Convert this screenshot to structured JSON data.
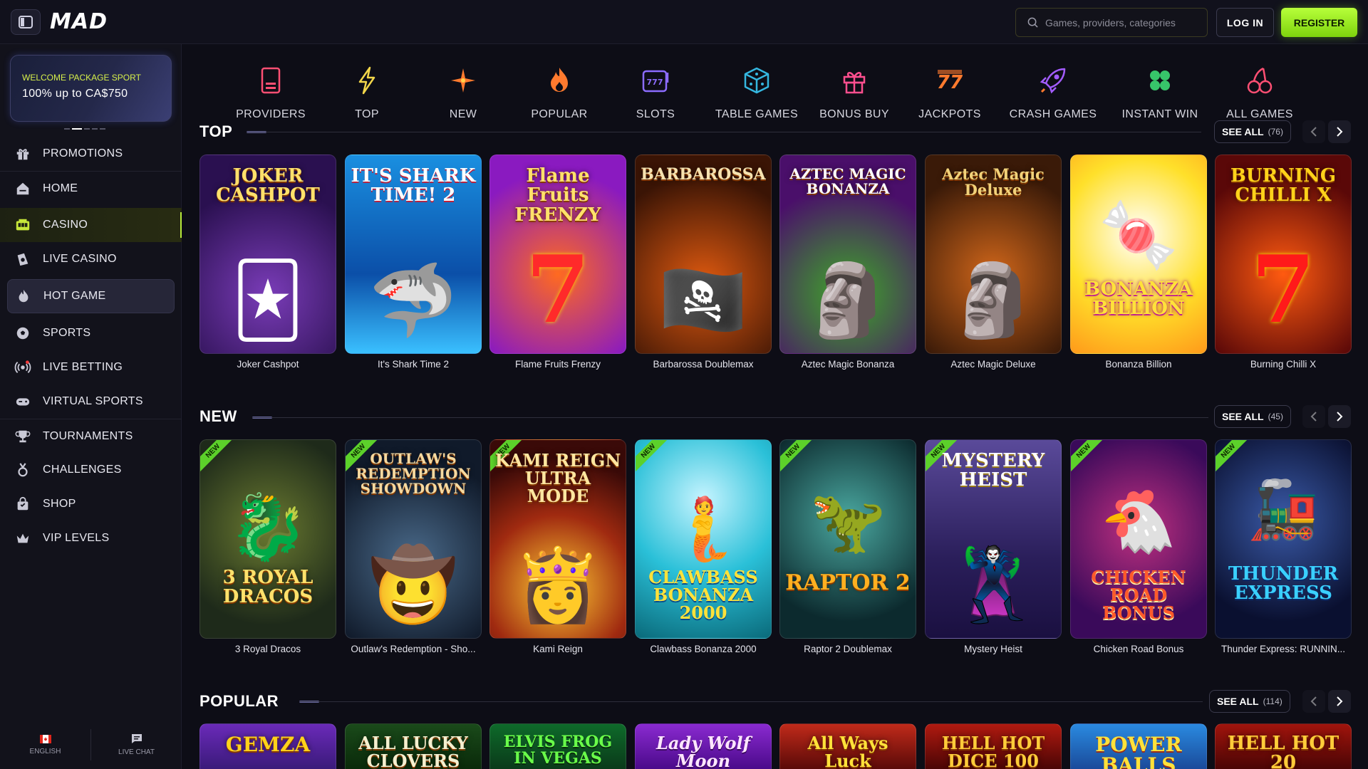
{
  "header": {
    "logo": "MAD",
    "search_placeholder": "Games, providers, categories",
    "login_label": "LOG IN",
    "register_label": "REGISTER"
  },
  "promo": {
    "line1": "WELCOME PACKAGE SPORT",
    "line2": "100% up to CA$750"
  },
  "sidebar": {
    "items": [
      {
        "label": "PROMOTIONS",
        "icon": "gift-icon"
      },
      {
        "label": "HOME",
        "icon": "home-icon"
      },
      {
        "label": "CASINO",
        "icon": "slot-machine-icon"
      },
      {
        "label": "LIVE CASINO",
        "icon": "live-casino-icon"
      },
      {
        "label": "HOT GAME",
        "icon": "flame-icon"
      },
      {
        "label": "SPORTS",
        "icon": "soccer-ball-icon"
      },
      {
        "label": "LIVE BETTING",
        "icon": "broadcast-icon"
      },
      {
        "label": "VIRTUAL SPORTS",
        "icon": "gamepad-icon"
      },
      {
        "label": "TOURNAMENTS",
        "icon": "trophy-icon"
      },
      {
        "label": "CHALLENGES",
        "icon": "medal-icon"
      },
      {
        "label": "SHOP",
        "icon": "shopping-bag-icon"
      },
      {
        "label": "VIP LEVELS",
        "icon": "crown-icon"
      }
    ],
    "language": "ENGLISH",
    "live_chat": "LIVE CHAT"
  },
  "categories": [
    {
      "label": "PROVIDERS",
      "icon": "providers-icon",
      "color": "#ff4f73"
    },
    {
      "label": "TOP",
      "icon": "lightning-icon",
      "color": "#f2d64a"
    },
    {
      "label": "NEW",
      "icon": "sparkle-icon",
      "color": "#ff7a2e"
    },
    {
      "label": "POPULAR",
      "icon": "flame-icon",
      "color": "#ff7a2e"
    },
    {
      "label": "SLOTS",
      "icon": "slots-777-icon",
      "color": "#8c6cff"
    },
    {
      "label": "TABLE GAMES",
      "icon": "dice-icon",
      "color": "#35b7e0"
    },
    {
      "label": "BONUS BUY",
      "icon": "gift-icon",
      "color": "#ff4f8f"
    },
    {
      "label": "JACKPOTS",
      "icon": "jackpot-777-icon",
      "color": "#ff7a2e"
    },
    {
      "label": "CRASH GAMES",
      "icon": "rocket-icon",
      "color": "#a35cff"
    },
    {
      "label": "INSTANT WIN",
      "icon": "clover-icon",
      "color": "#37c56a"
    },
    {
      "label": "ALL GAMES",
      "icon": "cherries-icon",
      "color": "#ff4f73"
    }
  ],
  "sections": {
    "top": {
      "title": "TOP",
      "see_all": "SEE ALL",
      "count": "(76)",
      "games": [
        {
          "name": "Joker Cashpot",
          "art": "JOKER CASHPOT"
        },
        {
          "name": "It's Shark Time 2",
          "art": "IT'S SHARK TIME! 2"
        },
        {
          "name": "Flame Fruits Frenzy",
          "art": "Flame Fruits FRENZY"
        },
        {
          "name": "Barbarossa Doublemax",
          "art": "BARBAROSSA"
        },
        {
          "name": "Aztec Magic Bonanza",
          "art": "AZTEC MAGIC BONANZA"
        },
        {
          "name": "Aztec Magic Deluxe",
          "art": "Aztec Magic Deluxe"
        },
        {
          "name": "Bonanza Billion",
          "art": "BONANZA BILLION"
        },
        {
          "name": "Burning Chilli X",
          "art": "BURNING CHILLI X"
        }
      ]
    },
    "new": {
      "title": "NEW",
      "see_all": "SEE ALL",
      "count": "(45)",
      "badge": "NEW",
      "games": [
        {
          "name": "3 Royal Dracos",
          "art": "3 ROYAL DRACOS"
        },
        {
          "name": "Outlaw's Redemption - Sho...",
          "art": "OUTLAW'S REDEMPTION SHOWDOWN"
        },
        {
          "name": "Kami Reign",
          "art": "KAMI REIGN ULTRA MODE"
        },
        {
          "name": "Clawbass Bonanza 2000",
          "art": "CLAWBASS BONANZA 2000"
        },
        {
          "name": "Raptor 2 Doublemax",
          "art": "RAPTOR 2"
        },
        {
          "name": "Mystery Heist",
          "art": "MYSTERY HEIST"
        },
        {
          "name": "Chicken Road Bonus",
          "art": "CHICKEN ROAD BONUS"
        },
        {
          "name": "Thunder Express: RUNNIN...",
          "art": "THUNDER EXPRESS"
        }
      ]
    },
    "popular": {
      "title": "POPULAR",
      "see_all": "SEE ALL",
      "count": "(114)",
      "games": [
        {
          "art": "GEMZA"
        },
        {
          "art": "ALL LUCKY CLOVERS"
        },
        {
          "art": "ELVIS FROG IN VEGAS"
        },
        {
          "art": "Lady Wolf Moon"
        },
        {
          "art": "All Ways Luck"
        },
        {
          "art": "HELL HOT DICE 100"
        },
        {
          "art": "POWER BALLS"
        },
        {
          "art": "HELL HOT 20"
        }
      ]
    }
  }
}
